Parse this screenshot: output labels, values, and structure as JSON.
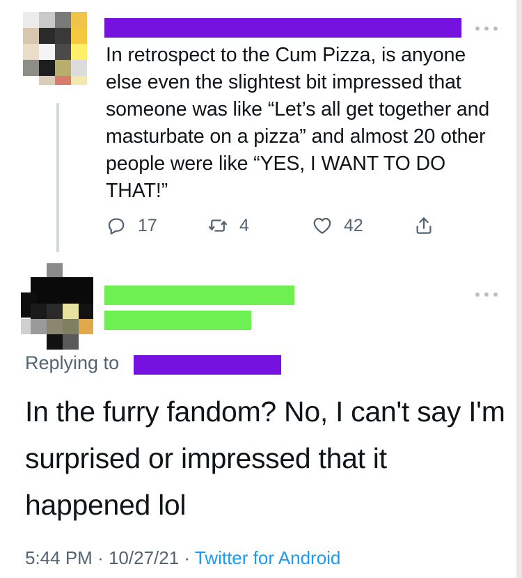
{
  "colors": {
    "redact_purple": "#7512e0",
    "redact_green": "#6ef052",
    "text": "#0f1419",
    "muted": "#536471",
    "link": "#1d9bf0"
  },
  "tweet1": {
    "text": "In retrospect to the Cum Pizza, is anyone else even the slightest bit impressed that someone was like “Let’s all get together and masturbate on a pizza” and almost 20 other people were like “YES, I WANT TO DO THAT!”",
    "replies": "17",
    "retweets": "4",
    "likes": "42"
  },
  "tweet2": {
    "replying_label": "Replying to",
    "text": "In the furry fandom? No, I can't say I'm surprised or impressed that it happened lol",
    "time": "5:44 PM",
    "date": "10/27/21",
    "separator": "·",
    "source": "Twitter for Android"
  },
  "icons": {
    "reply": "reply-icon",
    "retweet": "retweet-icon",
    "like": "heart-icon",
    "share": "share-icon",
    "more": "more-icon"
  }
}
